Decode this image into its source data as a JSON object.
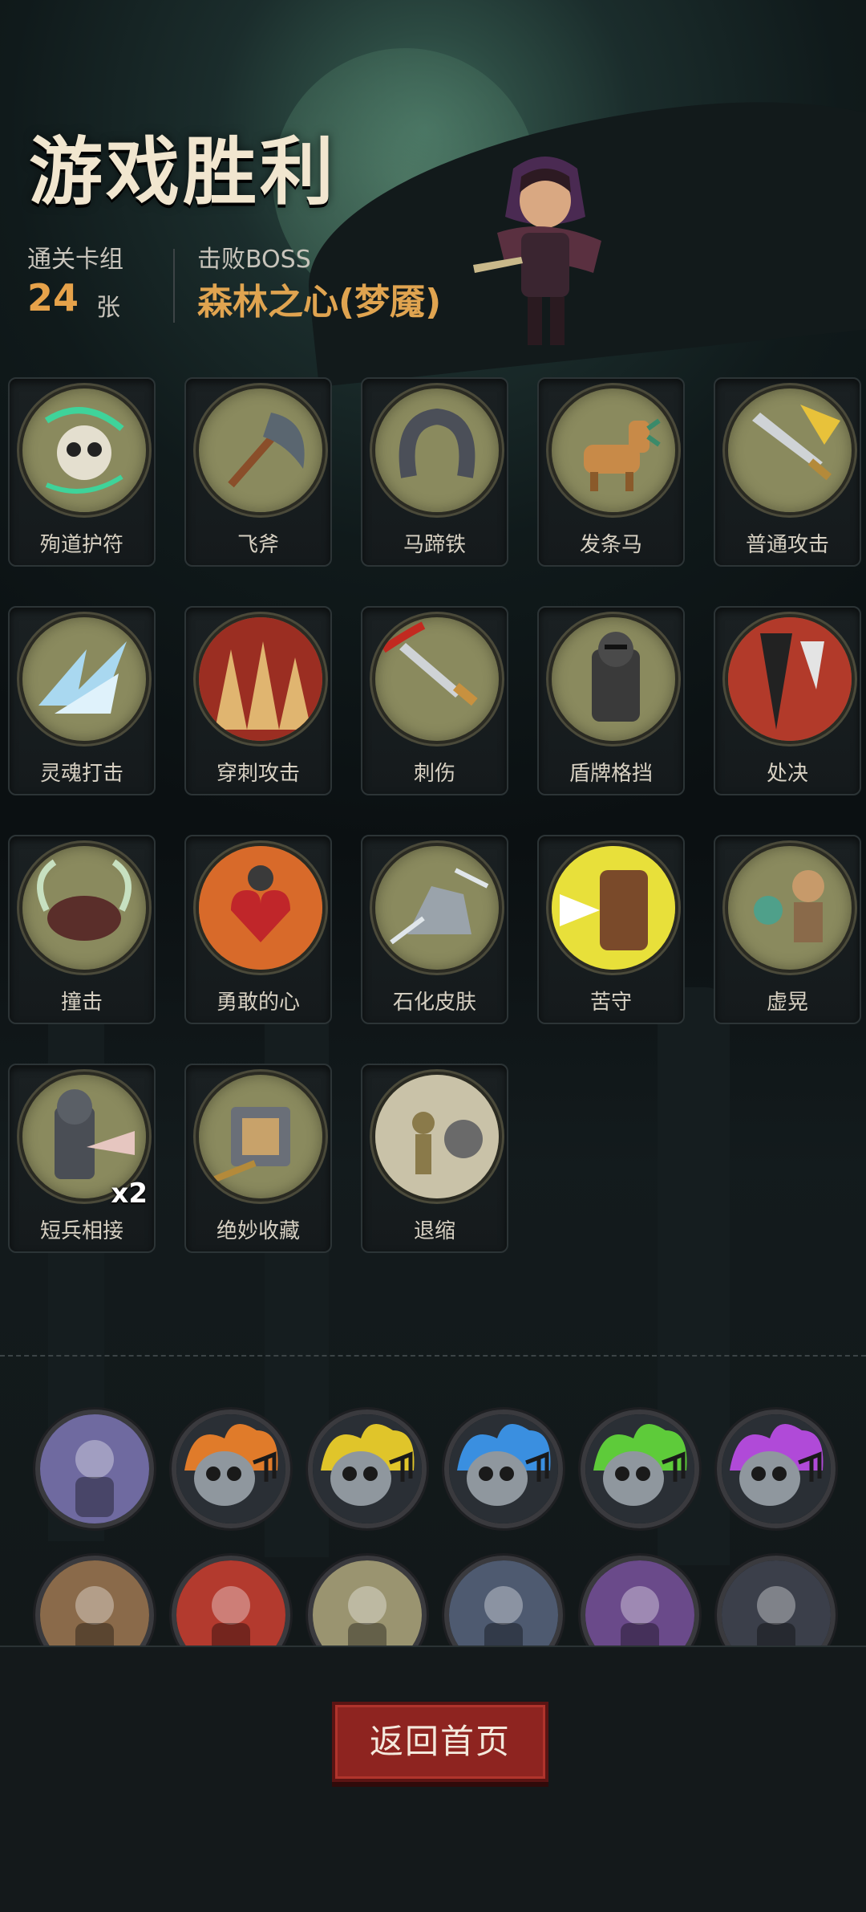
{
  "header": {
    "title": "游戏胜利",
    "deck_label": "通关卡组",
    "deck_count": "24",
    "deck_unit": "张",
    "boss_label": "击败BOSS",
    "boss_name": "森林之心(梦魇)"
  },
  "cards": [
    {
      "name": "殉道护符",
      "icon": "skull-amulet-icon"
    },
    {
      "name": "飞斧",
      "icon": "axe-icon"
    },
    {
      "name": "马蹄铁",
      "icon": "horseshoe-icon"
    },
    {
      "name": "发条马",
      "icon": "wind-up-horse-icon"
    },
    {
      "name": "普通攻击",
      "icon": "sword-icon"
    },
    {
      "name": "灵魂打击",
      "icon": "ice-shards-icon"
    },
    {
      "name": "穿刺攻击",
      "icon": "spikes-icon"
    },
    {
      "name": "刺伤",
      "icon": "dagger-icon"
    },
    {
      "name": "盾牌格挡",
      "icon": "shield-knight-icon"
    },
    {
      "name": "处决",
      "icon": "execute-icon"
    },
    {
      "name": "撞击",
      "icon": "boar-icon"
    },
    {
      "name": "勇敢的心",
      "icon": "brave-heart-icon"
    },
    {
      "name": "石化皮肤",
      "icon": "stone-skin-icon"
    },
    {
      "name": "苦守",
      "icon": "barrel-shield-icon"
    },
    {
      "name": "虚晃",
      "icon": "boxer-icon"
    },
    {
      "name": "短兵相接",
      "icon": "knight-clash-icon",
      "count": "x2"
    },
    {
      "name": "绝妙收藏",
      "icon": "treasure-book-icon"
    },
    {
      "name": "退缩",
      "icon": "retreat-icon"
    }
  ],
  "relics_row1": [
    {
      "icon": "octopus-icon",
      "color": "#6f6aa0"
    },
    {
      "icon": "flame-skull-orange-icon",
      "color": "#e07b2a"
    },
    {
      "icon": "flame-skull-yellow-icon",
      "color": "#e0c52a"
    },
    {
      "icon": "flame-skull-blue-icon",
      "color": "#3a8fe0"
    },
    {
      "icon": "flame-skull-green-icon",
      "color": "#5ecb3a"
    },
    {
      "icon": "flame-skull-purple-icon",
      "color": "#b04ad8"
    }
  ],
  "relics_row2": [
    {
      "icon": "warrior-icon",
      "color": "#8a6a4a"
    },
    {
      "icon": "red-skull-icon",
      "color": "#b33a2e"
    },
    {
      "icon": "rose-blade-icon",
      "color": "#9a9470"
    },
    {
      "icon": "ghost-orc-icon",
      "color": "#4e5a70"
    },
    {
      "icon": "red-cape-icon",
      "color": "#6a4a8a"
    },
    {
      "icon": "sword-ninja-icon",
      "color": "#3b3f4a"
    }
  ],
  "back_button": "返回首页"
}
